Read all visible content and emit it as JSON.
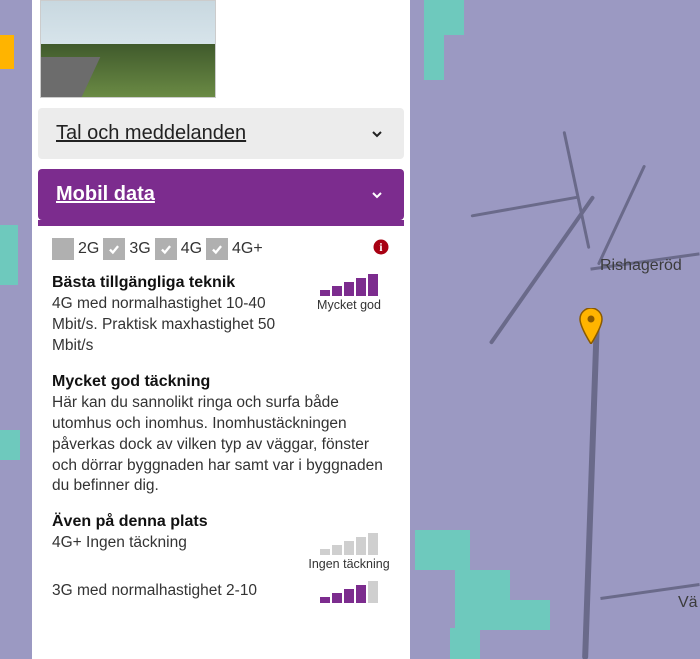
{
  "map": {
    "label1": "Rishageröd",
    "label2": "Vä"
  },
  "accordions": {
    "voice": {
      "title": "Tal och meddelanden"
    },
    "data": {
      "title": "Mobil data"
    }
  },
  "tech": {
    "g2": "2G",
    "g3": "3G",
    "g4": "4G",
    "g4p": "4G+"
  },
  "best": {
    "title": "Bästa tillgängliga teknik",
    "body": "4G med normalhastighet 10-40 Mbit/s. Praktisk maxhastighet 50 Mbit/s",
    "signal_label": "Mycket god"
  },
  "coverage": {
    "title": "Mycket god täckning",
    "body": "Här kan du sannolikt ringa och surfa både utomhus och inomhus. Inomhustäckningen påverkas dock av vilken typ av väggar, fönster och dörrar byggnaden har samt var i byggnaden du befinner dig."
  },
  "also": {
    "title": "Även på denna plats",
    "line1": "4G+ Ingen täckning",
    "signal_label": "Ingen täckning",
    "line2": "3G med normalhastighet 2-10"
  }
}
